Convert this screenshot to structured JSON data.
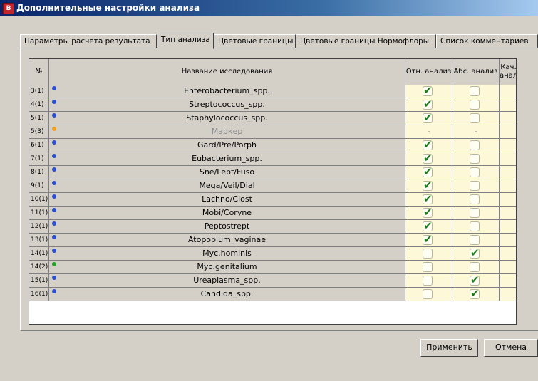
{
  "window": {
    "title": "Дополнительные настройки анализа",
    "icon_letter": "В"
  },
  "tabs": [
    {
      "label": "Параметры расчёта результата",
      "active": false
    },
    {
      "label": "Тип анализа",
      "active": true
    },
    {
      "label": "Цветовые границы",
      "active": false
    },
    {
      "label": "Цветовые границы Нормофлоры",
      "active": false
    },
    {
      "label": "Список комментариев",
      "active": false
    }
  ],
  "table": {
    "headers": {
      "num": "№",
      "name": "Название исследования",
      "rel": "Отн. анализ",
      "abs": "Абс. анализ",
      "qual": "Кач. анализ"
    },
    "rows": [
      {
        "num": "3(1)",
        "name": "Enterobacterium_spp.",
        "dot": "#2a4fd0",
        "rel": "✔",
        "abs": "",
        "qual": ""
      },
      {
        "num": "4(1)",
        "name": "Streptococcus_spp.",
        "dot": "#2a4fd0",
        "rel": "✔",
        "abs": "",
        "qual": ""
      },
      {
        "num": "5(1)",
        "name": "Staphylococcus_spp.",
        "dot": "#2a4fd0",
        "rel": "✔",
        "abs": "",
        "qual": ""
      },
      {
        "num": "5(3)",
        "name": "Маркер",
        "dot": "#f0a020",
        "rel": "-",
        "abs": "-",
        "qual": "-",
        "dim": true
      },
      {
        "num": "6(1)",
        "name": "Gard/Pre/Porph",
        "dot": "#2a4fd0",
        "rel": "✔",
        "abs": "",
        "qual": ""
      },
      {
        "num": "7(1)",
        "name": "Eubacterium_spp.",
        "dot": "#2a4fd0",
        "rel": "✔",
        "abs": "",
        "qual": ""
      },
      {
        "num": "8(1)",
        "name": "Sne/Lept/Fuso",
        "dot": "#2a4fd0",
        "rel": "✔",
        "abs": "",
        "qual": ""
      },
      {
        "num": "9(1)",
        "name": "Mega/Veil/Dial",
        "dot": "#2a4fd0",
        "rel": "✔",
        "abs": "",
        "qual": ""
      },
      {
        "num": "10(1)",
        "name": "Lachno/Clost",
        "dot": "#2a4fd0",
        "rel": "✔",
        "abs": "",
        "qual": ""
      },
      {
        "num": "11(1)",
        "name": "Mobi/Coryne",
        "dot": "#2a4fd0",
        "rel": "✔",
        "abs": "",
        "qual": ""
      },
      {
        "num": "12(1)",
        "name": "Peptostrept",
        "dot": "#2a4fd0",
        "rel": "✔",
        "abs": "",
        "qual": ""
      },
      {
        "num": "13(1)",
        "name": "Atopobium_vaginae",
        "dot": "#2a4fd0",
        "rel": "✔",
        "abs": "",
        "qual": ""
      },
      {
        "num": "14(1)",
        "name": "Myc.hominis",
        "dot": "#2a4fd0",
        "rel": "",
        "abs": "✔",
        "qual": ""
      },
      {
        "num": "14(2)",
        "name": "Myc.genitalium",
        "dot": "#2aa02a",
        "rel": "",
        "abs": "",
        "qual": "✔"
      },
      {
        "num": "15(1)",
        "name": "Ureaplasma_spp.",
        "dot": "#2a4fd0",
        "rel": "",
        "abs": "✔",
        "qual": ""
      },
      {
        "num": "16(1)",
        "name": "Candida_spp.",
        "dot": "#2a4fd0",
        "rel": "",
        "abs": "✔",
        "qual": ""
      }
    ]
  },
  "buttons": {
    "apply": "Применить",
    "cancel": "Отмена"
  }
}
